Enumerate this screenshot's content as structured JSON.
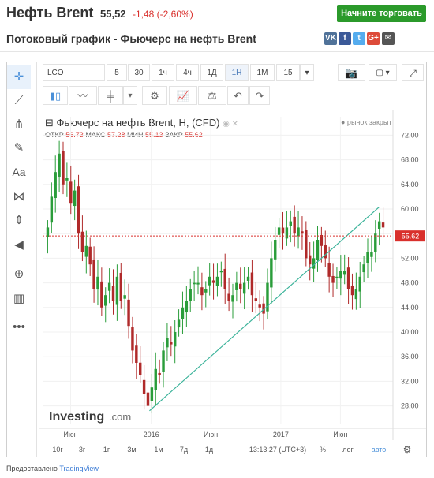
{
  "header": {
    "title": "Нефть Brent",
    "price": "55,52",
    "change": "-1,48 (-2,60%)",
    "trade_button": "Начните торговать",
    "subtitle": "Потоковый график - Фьючерс на нефть Brent"
  },
  "share": [
    {
      "icon": "vk-icon",
      "glyph": "VK",
      "color": "#507299"
    },
    {
      "icon": "facebook-icon",
      "glyph": "f",
      "color": "#3b5998"
    },
    {
      "icon": "twitter-icon",
      "glyph": "t",
      "color": "#55acee"
    },
    {
      "icon": "google-plus-icon",
      "glyph": "G+",
      "color": "#dd4b39"
    },
    {
      "icon": "email-icon",
      "glyph": "✉",
      "color": "#555555"
    }
  ],
  "toolbar": {
    "symbol": "LCO",
    "intervals": [
      "5",
      "30",
      "1ч",
      "4ч",
      "1Д",
      "1Н",
      "1М",
      "15"
    ],
    "selected_interval": "1Н"
  },
  "left_tools": [
    "crosshair-icon",
    "trendline-icon",
    "pitchfork-icon",
    "brush-icon",
    "text-tool-icon",
    "pattern-icon",
    "measure-icon",
    "arrow-left-icon",
    "zoom-icon",
    "ruler-icon",
    "more-icon"
  ],
  "text_tool_label": "Aa",
  "legend": {
    "title": "Фьючерс на нефть Brent, H, (CFD)",
    "ohlc_labels": [
      "ОТКР",
      "МАКС",
      "МИН",
      "ЗАКР"
    ],
    "ohlc_values": [
      "56.73",
      "57.28",
      "55.13",
      "55.62"
    ],
    "status": "● рынок закрыт"
  },
  "watermark": {
    "brand": "Investing",
    "suffix": ".com"
  },
  "bottom": {
    "ranges": [
      "10г",
      "3г",
      "1г",
      "3м",
      "1м",
      "7д",
      "1д"
    ],
    "time": "13:13:27 (UTC+3)",
    "percent": "%",
    "log": "лог",
    "auto": "авто"
  },
  "credit": {
    "prefix": "Предоставлено",
    "link": "TradingView"
  },
  "colors": {
    "up": "#2a9d3a",
    "down": "#b02a2a",
    "trend": "#3bb39a",
    "price_line": "#d9302c",
    "accent": "#4a90d9"
  },
  "chart_data": {
    "type": "candlestick",
    "title": "Фьючерс на нефть Brent, H, (CFD)",
    "last_price": "55.62",
    "ylim": [
      25,
      75
    ],
    "yticks": [
      "72.00",
      "68.00",
      "64.00",
      "60.00",
      "56.00",
      "52.00",
      "48.00",
      "44.00",
      "40.00",
      "36.00",
      "32.00",
      "28.00"
    ],
    "x_tick_labels": [
      "Июн",
      "2016",
      "Июн",
      "2017",
      "Июн"
    ],
    "series": [
      {
        "values": [
          57,
          62,
          66,
          69,
          64,
          65,
          61,
          63,
          56,
          53,
          54,
          51,
          47,
          49,
          44,
          46,
          48,
          45,
          49,
          45,
          46,
          41,
          37,
          35,
          33,
          30,
          28,
          31,
          34,
          33,
          37,
          39,
          38,
          40,
          42,
          44,
          45,
          47,
          48,
          48,
          46,
          47,
          49,
          48,
          49,
          50,
          47,
          45,
          46,
          48,
          47,
          48,
          49,
          46,
          45,
          44,
          43,
          48,
          52,
          55,
          57,
          56,
          57,
          58,
          56,
          57,
          56,
          52,
          51,
          52,
          55,
          54,
          52,
          49,
          48,
          49,
          50,
          50,
          47,
          46,
          47,
          49,
          51,
          53,
          53,
          56,
          58,
          57
        ]
      }
    ],
    "trendline": {
      "from": [
        -1,
        27.2
      ],
      "to": [
        1,
        60.3
      ]
    }
  }
}
